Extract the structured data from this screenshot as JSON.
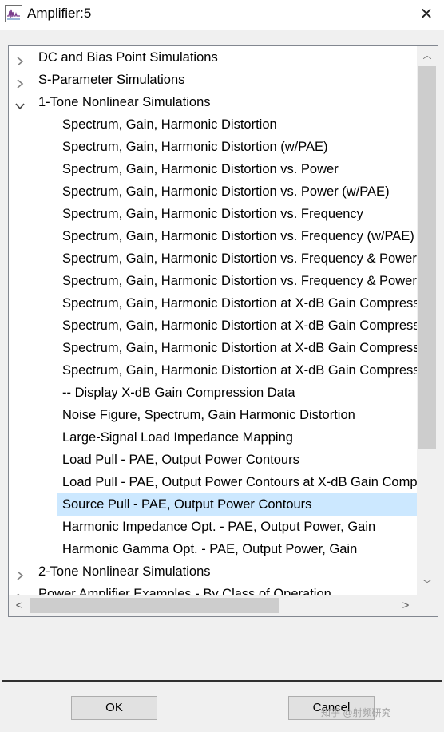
{
  "window": {
    "title": "Amplifier:5",
    "icon": "waveform-icon",
    "close_glyph": "✕"
  },
  "tree": {
    "items": [
      {
        "label": "DC and Bias Point Simulations",
        "level": 0,
        "expanded": false
      },
      {
        "label": "S-Parameter Simulations",
        "level": 0,
        "expanded": false
      },
      {
        "label": "1-Tone Nonlinear Simulations",
        "level": 0,
        "expanded": true
      },
      {
        "label": "Spectrum, Gain, Harmonic Distortion",
        "level": 1
      },
      {
        "label": "Spectrum, Gain, Harmonic Distortion (w/PAE)",
        "level": 1
      },
      {
        "label": "Spectrum, Gain, Harmonic Distortion vs. Power",
        "level": 1
      },
      {
        "label": "Spectrum, Gain, Harmonic Distortion vs. Power (w/PAE)",
        "level": 1
      },
      {
        "label": "Spectrum, Gain, Harmonic Distortion vs. Frequency",
        "level": 1
      },
      {
        "label": "Spectrum, Gain, Harmonic Distortion vs. Frequency (w/PAE)",
        "level": 1
      },
      {
        "label": "Spectrum, Gain, Harmonic Distortion vs. Frequency & Power",
        "level": 1
      },
      {
        "label": "Spectrum, Gain, Harmonic Distortion vs. Frequency & Power (w/PAE)",
        "level": 1
      },
      {
        "label": "Spectrum, Gain, Harmonic Distortion at X-dB Gain Compression",
        "level": 1
      },
      {
        "label": "Spectrum, Gain, Harmonic Distortion at X-dB Gain Compression (w/PAE)",
        "level": 1
      },
      {
        "label": "Spectrum, Gain, Harmonic Distortion at X-dB Gain Compression vs. Frequency",
        "level": 1
      },
      {
        "label": "Spectrum, Gain, Harmonic Distortion at X-dB Gain Compression vs. Frequency (w/PAE)",
        "level": 1
      },
      {
        "label": "-- Display X-dB Gain Compression Data",
        "level": 1
      },
      {
        "label": "Noise Figure, Spectrum, Gain Harmonic Distortion",
        "level": 1
      },
      {
        "label": "Large-Signal Load Impedance Mapping",
        "level": 1
      },
      {
        "label": "Load Pull - PAE, Output Power Contours",
        "level": 1
      },
      {
        "label": "Load Pull - PAE, Output Power Contours at X-dB Gain Compression",
        "level": 1
      },
      {
        "label": "Source Pull - PAE, Output Power Contours",
        "level": 1,
        "selected": true
      },
      {
        "label": "Harmonic Impedance Opt. - PAE, Output Power, Gain",
        "level": 1
      },
      {
        "label": "Harmonic Gamma Opt. - PAE, Output Power, Gain",
        "level": 1
      },
      {
        "label": "2-Tone Nonlinear Simulations",
        "level": 0,
        "expanded": false
      },
      {
        "label": "Power Amplifier Examples - By Class of Operation",
        "level": 0,
        "expanded": false
      }
    ]
  },
  "scrollbars": {
    "up_glyph": "︿",
    "down_glyph": "﹀",
    "left_glyph": "<",
    "right_glyph": ">"
  },
  "buttons": {
    "ok_label": "OK",
    "cancel_label": "Cancel"
  },
  "watermark": "知乎 @射频研究",
  "colors": {
    "selection": "#cce8ff",
    "window_bg": "#f0f0f0",
    "scroll_thumb": "#cdcdcd"
  }
}
